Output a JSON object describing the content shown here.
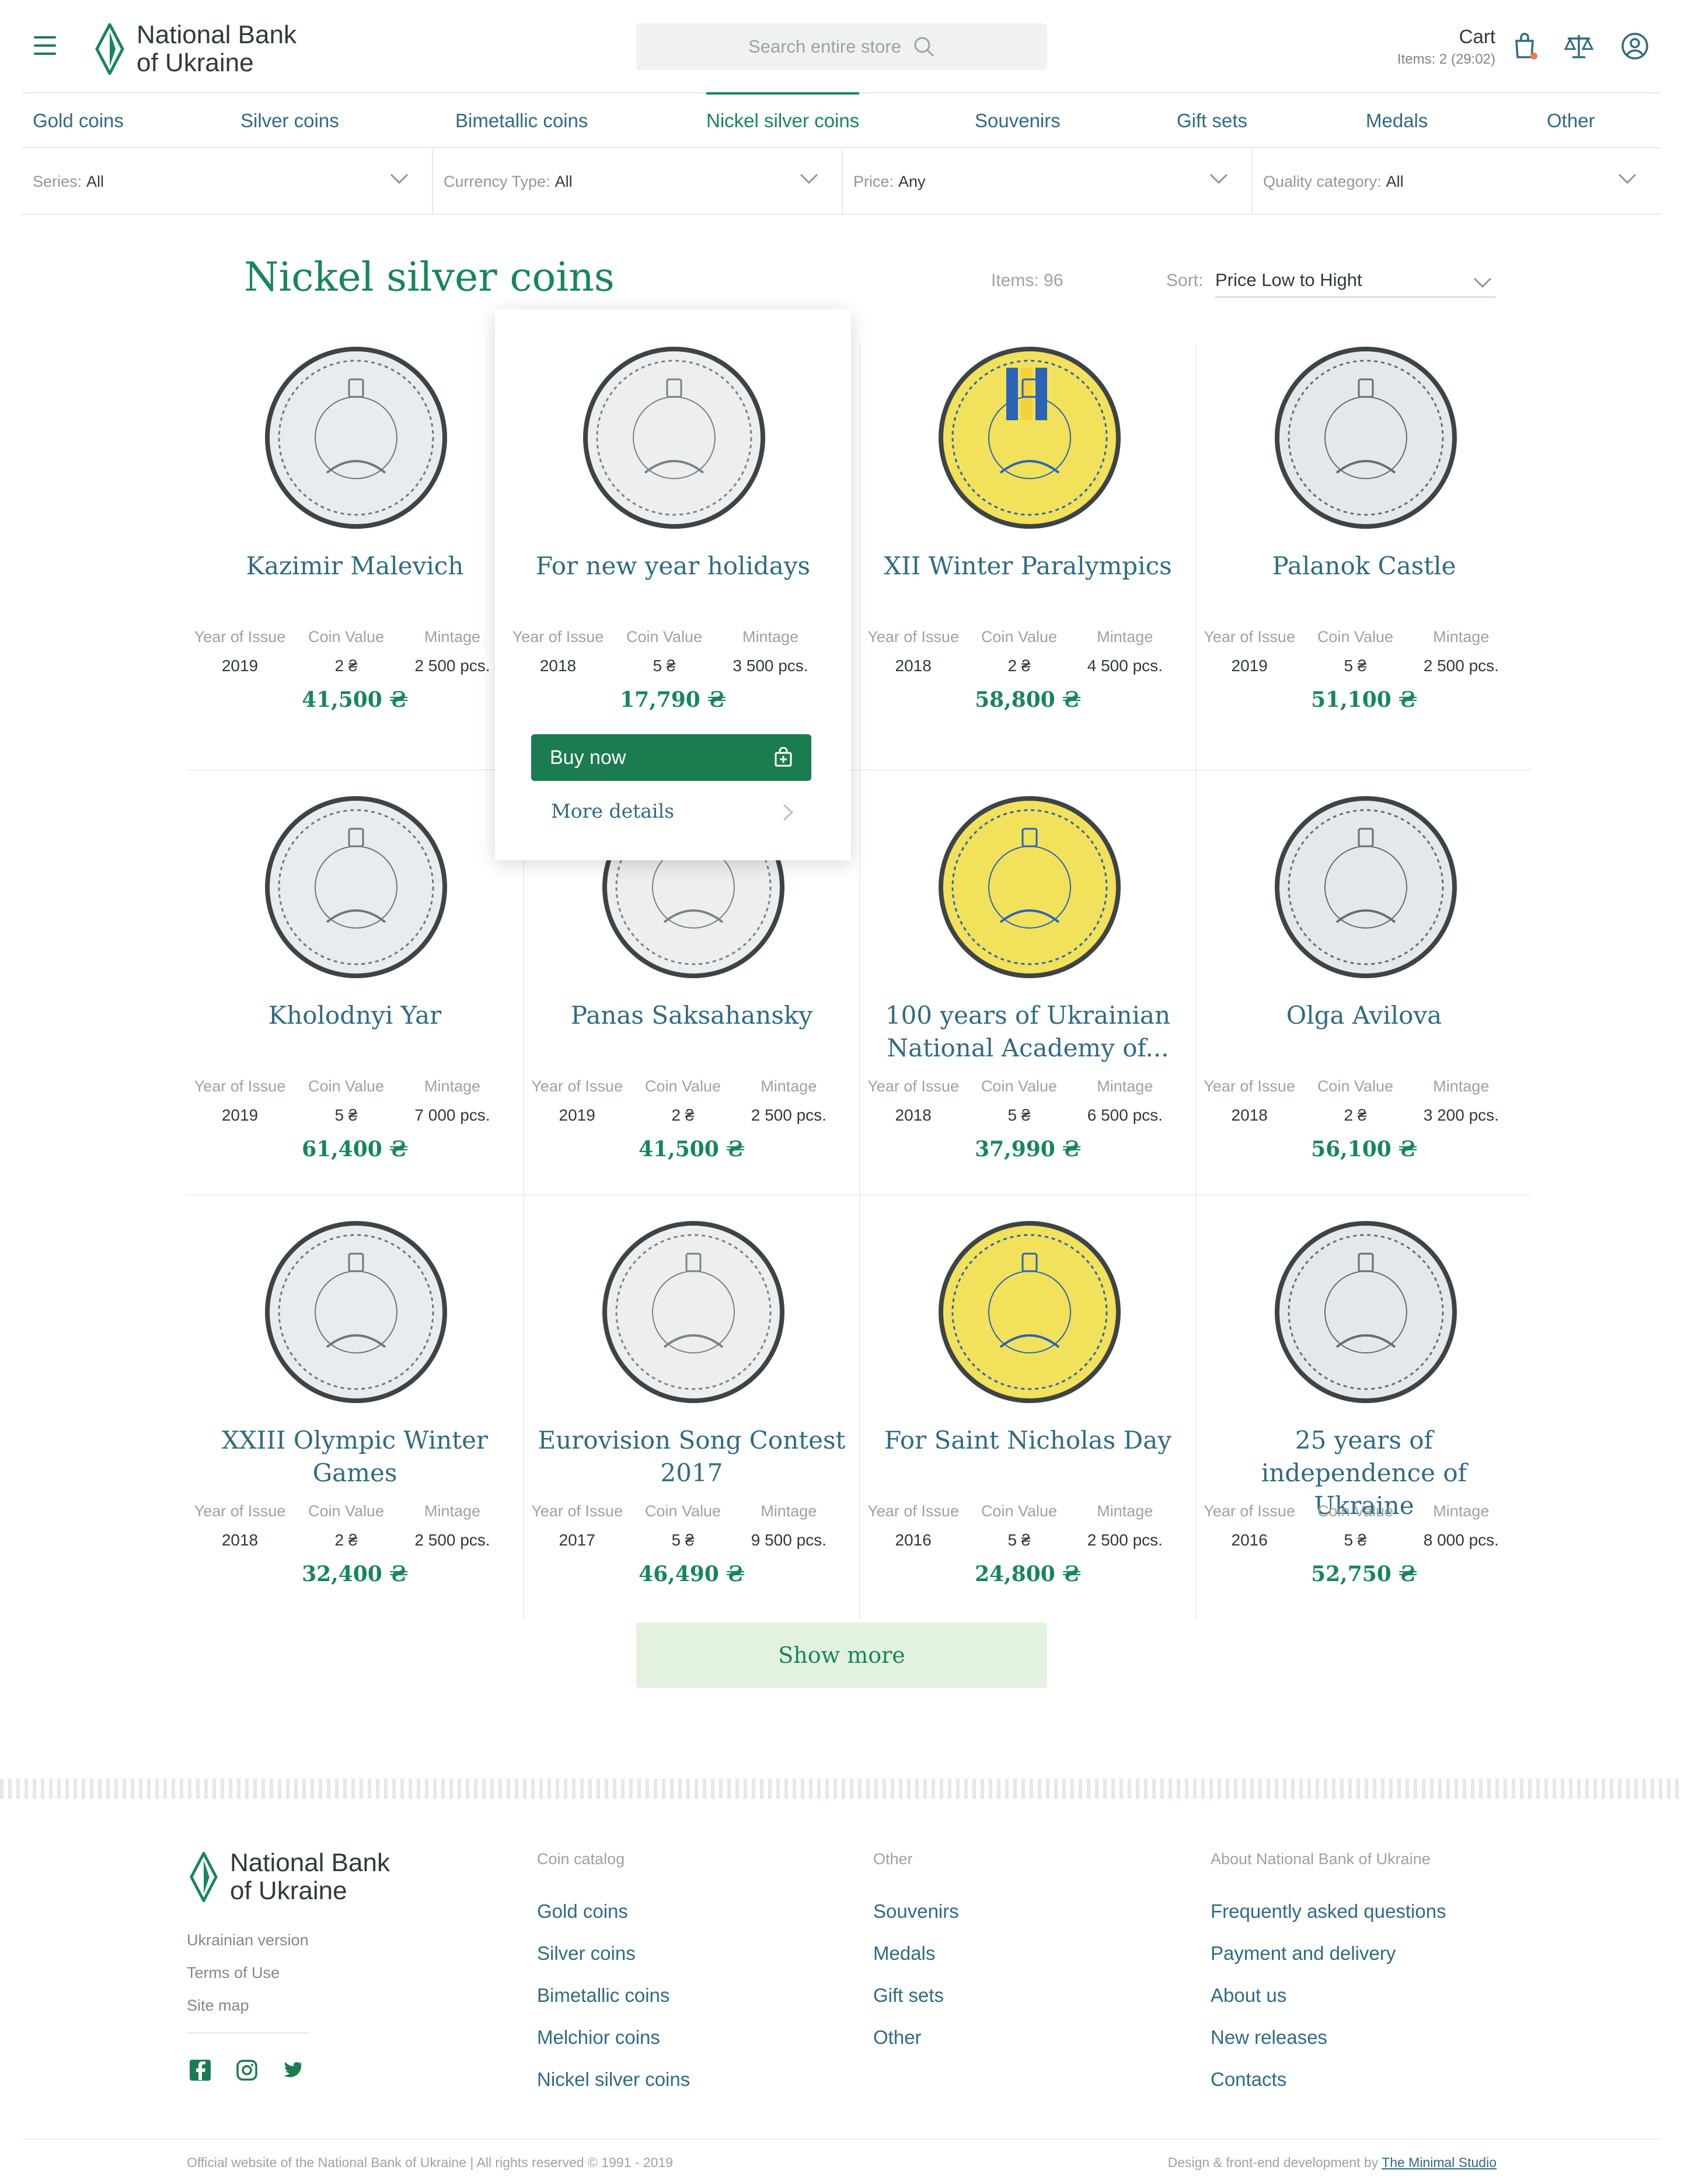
{
  "brand": {
    "name_line1": "National Bank",
    "name_line2": "of Ukraine",
    "color": "#16865c"
  },
  "search": {
    "placeholder": "Search entire store"
  },
  "cart": {
    "title": "Cart",
    "items": "Items: 2 (29:02)"
  },
  "categories": [
    "Gold coins",
    "Silver coins",
    "Bimetallic coins",
    "Nickel silver coins",
    "Souvenirs",
    "Gift sets",
    "Medals",
    "Other"
  ],
  "active_category": "Nickel silver coins",
  "filters": [
    {
      "label": "Series:",
      "value": "All"
    },
    {
      "label": "Currency Type:",
      "value": "All"
    },
    {
      "label": "Price:",
      "value": "Any"
    },
    {
      "label": "Quality category:",
      "value": "All"
    }
  ],
  "page": {
    "title": "Nickel silver coins",
    "items": "Items: 96",
    "sort_label": "Sort:",
    "sort_value": "Price Low to Hight"
  },
  "spec_labels": {
    "year": "Year of Issue",
    "value": "Coin Value",
    "mintage": "Mintage"
  },
  "products": [
    {
      "name": "Kazimir Malevich",
      "year": "2019",
      "value": "2 ₴",
      "mintage": "2 500 pcs.",
      "price": "41,500 ₴",
      "icon": "malevich-coin-icon"
    },
    {
      "name": "For new year holidays",
      "year": "2018",
      "value": "5 ₴",
      "mintage": "3 500 pcs.",
      "price": "17,790 ₴",
      "icon": "new-year-coin-icon"
    },
    {
      "name": "XII Winter Paralympics",
      "year": "2018",
      "value": "2 ₴",
      "mintage": "4 500 pcs.",
      "price": "58,800 ₴",
      "icon": "paralympics-coin-icon"
    },
    {
      "name": "Palanok Castle",
      "year": "2019",
      "value": "5 ₴",
      "mintage": "2 500 pcs.",
      "price": "51,100 ₴",
      "icon": "castle-coin-icon"
    },
    {
      "name": "Kholodnyi Yar",
      "year": "2019",
      "value": "5 ₴",
      "mintage": "7 000 pcs.",
      "price": "61,400 ₴",
      "icon": "kholodnyi-yar-coin-icon"
    },
    {
      "name": "Panas Saksahansky",
      "year": "2019",
      "value": "2 ₴",
      "mintage": "2 500 pcs.",
      "price": "41,500 ₴",
      "icon": "saksahansky-coin-icon"
    },
    {
      "name": "100 years of Ukrainian National Academy of...",
      "year": "2018",
      "value": "5 ₴",
      "mintage": "6 500 pcs.",
      "price": "37,990 ₴",
      "icon": "academy-coin-icon"
    },
    {
      "name": "Olga Avilova",
      "year": "2018",
      "value": "2 ₴",
      "mintage": "3 200 pcs.",
      "price": "56,100 ₴",
      "icon": "avilova-coin-icon"
    },
    {
      "name": "XXIII Olympic Winter Games",
      "year": "2018",
      "value": "2 ₴",
      "mintage": "2 500 pcs.",
      "price": "32,400 ₴",
      "icon": "olympic-coin-icon"
    },
    {
      "name": "Eurovision Song Contest 2017",
      "year": "2017",
      "value": "5 ₴",
      "mintage": "9 500 pcs.",
      "price": "46,490 ₴",
      "icon": "eurovision-coin-icon"
    },
    {
      "name": "For Saint Nicholas Day",
      "year": "2016",
      "value": "5 ₴",
      "mintage": "2 500 pcs.",
      "price": "24,800 ₴",
      "icon": "saint-nicholas-coin-icon"
    },
    {
      "name": "25 years of independence of Ukraine",
      "year": "2016",
      "value": "5 ₴",
      "mintage": "8 000 pcs.",
      "price": "52,750 ₴",
      "icon": "independence-coin-icon"
    }
  ],
  "hover_card": {
    "buy": "Buy now",
    "details": "More details"
  },
  "show_more": "Show more",
  "footer": {
    "links": [
      "Ukrainian version",
      "Terms of Use",
      "Site map"
    ],
    "col1": {
      "title": "Coin catalog",
      "items": [
        "Gold coins",
        "Silver coins",
        "Bimetallic coins",
        "Melchior coins",
        "Nickel silver coins"
      ]
    },
    "col2": {
      "title": "Other",
      "items": [
        "Souvenirs",
        "Medals",
        "Gift sets",
        "Other"
      ]
    },
    "col3": {
      "title": "About National Bank of Ukraine",
      "items": [
        "Frequently asked questions",
        "Payment and delivery",
        "About us",
        "New releases",
        "Contacts"
      ]
    },
    "copyright": "Official website of the National Bank of Ukraine | All rights reserved © 1991 - 2019",
    "credit_prefix": "Design & front-end development by",
    "credit_link": "The Minimal Studio"
  }
}
